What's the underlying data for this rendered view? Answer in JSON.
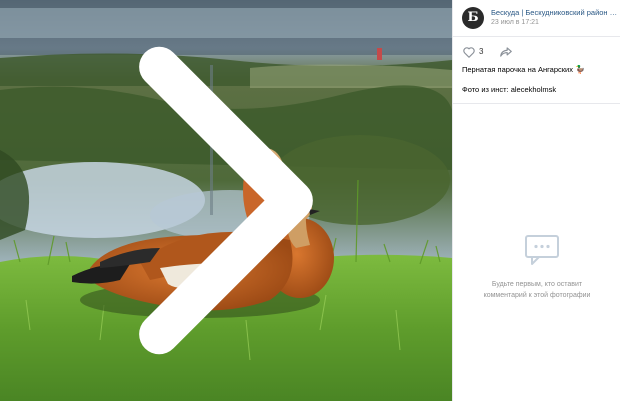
{
  "post": {
    "avatar_letter": "Б",
    "author": "Бескуда | Бескудниковский район М...",
    "date": "23 июл в 17:21",
    "likes": "3",
    "caption": "Пернатая парочка на Ангарских",
    "caption_emoji": "🦆",
    "credit": "Фото из инст: alecekholmsk"
  },
  "comments": {
    "empty_line1": "Будьте первым, кто оставит",
    "empty_line2": "комментарий к этой фотографии"
  },
  "icons": {
    "like": "heart-icon",
    "share": "share-arrow-icon",
    "next": "chevron-right-icon",
    "comments_empty": "chat-bubble-icon"
  },
  "colors": {
    "link": "#2a5885",
    "muted": "#939393",
    "divider": "#e7e8ec"
  }
}
